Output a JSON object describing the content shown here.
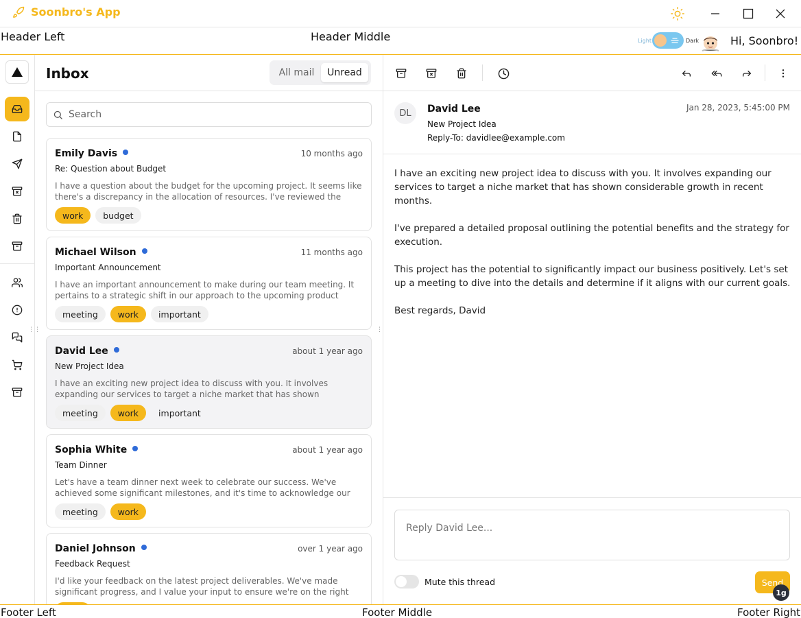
{
  "app": {
    "title": "Soonbro's App"
  },
  "header": {
    "left": "Header Left",
    "middle": "Header Middle",
    "theme_light_label": "Light",
    "theme_dark_label": "Dark",
    "greeting": "Hi, Soonbro!"
  },
  "list": {
    "title": "Inbox",
    "filters": [
      {
        "label": "All mail",
        "selected": false
      },
      {
        "label": "Unread",
        "selected": true
      }
    ],
    "search_placeholder": "Search",
    "mails": [
      {
        "name": "Emily Davis",
        "time": "10 months ago",
        "subject": "Re: Question about Budget",
        "preview": "I have a question about the budget for the upcoming project. It seems like there's a discrepancy in the allocation of resources. I've reviewed the budget report and identified a few areas where we might be able to optimize",
        "tags": [
          "work",
          "budget"
        ],
        "unread": true,
        "selected": false
      },
      {
        "name": "Michael Wilson",
        "time": "11 months ago",
        "subject": "Important Announcement",
        "preview": "I have an important announcement to make during our team meeting. It pertains to a strategic shift in our approach to the upcoming product launch. We've received valuable feedback from our beta testers",
        "tags": [
          "meeting",
          "work",
          "important"
        ],
        "unread": true,
        "selected": false
      },
      {
        "name": "David Lee",
        "time": "about 1 year ago",
        "subject": "New Project Idea",
        "preview": "I have an exciting new project idea to discuss with you. It involves expanding our services to target a niche market that has shown considerable growth in recent months.",
        "tags": [
          "meeting",
          "work",
          "important"
        ],
        "unread": true,
        "selected": true
      },
      {
        "name": "Sophia White",
        "time": "about 1 year ago",
        "subject": "Team Dinner",
        "preview": "Let's have a team dinner next week to celebrate our success. We've achieved some significant milestones, and it's time to acknowledge our hard work and dedication.",
        "tags": [
          "meeting",
          "work"
        ],
        "unread": true,
        "selected": false
      },
      {
        "name": "Daniel Johnson",
        "time": "over 1 year ago",
        "subject": "Feedback Request",
        "preview": "I'd like your feedback on the latest project deliverables. We've made significant progress, and I value your input to ensure we're on the right track. I've attached the documents for your review",
        "tags": [
          "work"
        ],
        "unread": true,
        "selected": false
      }
    ]
  },
  "detail": {
    "avatar_initials": "DL",
    "from": "David Lee",
    "subject": "New Project Idea",
    "reply_to": "Reply-To: davidlee@example.com",
    "date": "Jan 28, 2023, 5:45:00 PM",
    "body": [
      "I have an exciting new project idea to discuss with you. It involves expanding our services to target a niche market that has shown considerable growth in recent months.",
      "I've prepared a detailed proposal outlining the potential benefits and the strategy for execution.",
      "This project has the potential to significantly impact our business positively. Let's set up a meeting to dive into the details and determine if it aligns with our current goals.",
      "Best regards, David"
    ],
    "reply_placeholder": "Reply David Lee...",
    "mute_label": "Mute this thread",
    "send_label": "Send",
    "badge": "1g"
  },
  "footer": {
    "left": "Footer Left",
    "middle": "Footer Middle",
    "right": "Footer Right"
  },
  "colors": {
    "accent": "#f5b81c",
    "unread_dot": "#2f6bd8",
    "toggle_track": "#7ac7ef"
  },
  "icons": {
    "rail": [
      "inbox-icon",
      "file-icon",
      "send-icon",
      "archive-x-icon",
      "trash-icon",
      "archive-icon",
      "users-icon",
      "alert-circle-icon",
      "messages-icon",
      "shopping-cart-icon",
      "archive-icon"
    ],
    "toolbar": [
      "archive-icon",
      "archive-x-icon",
      "trash-icon",
      "clock-icon",
      "reply-icon",
      "reply-all-icon",
      "forward-icon",
      "more-vertical-icon"
    ]
  }
}
